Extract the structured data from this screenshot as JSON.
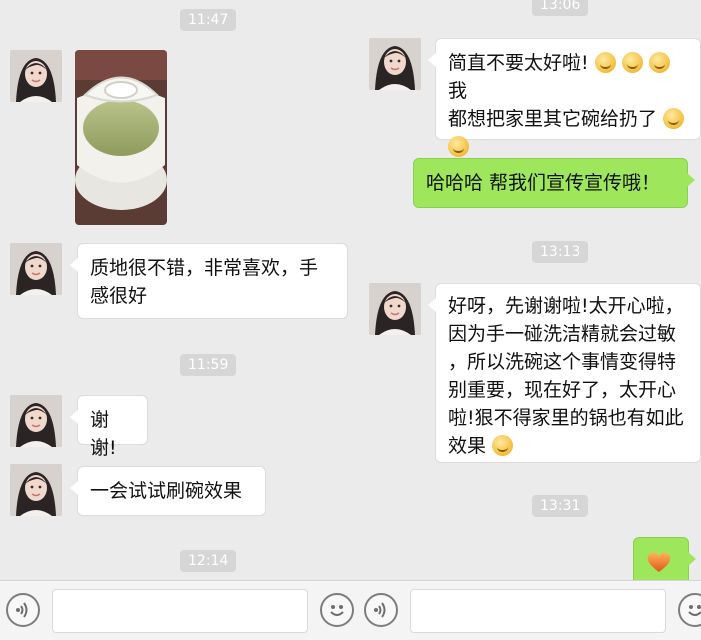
{
  "left_screen": {
    "timestamps": [
      "11:47",
      "11:59",
      "12:14"
    ],
    "messages": [
      {
        "type": "image",
        "content": "bowl-photo"
      },
      {
        "type": "text",
        "line1": "质地很不错，非常喜欢，手",
        "line2": "感很好"
      },
      {
        "type": "text",
        "text": "谢谢!"
      },
      {
        "type": "text",
        "text": "一会试试刷碗效果"
      }
    ],
    "input": {
      "voice_icon": "voice-icon",
      "emoji_icon": "smiley-icon"
    }
  },
  "right_screen": {
    "timestamps": [
      "13:06",
      "13:13",
      "13:31"
    ],
    "messages": [
      {
        "type": "text",
        "line1_before": "简直不要太好啦!",
        "line1_after": "我",
        "line2": "都想把家里其它碗给扔了"
      },
      {
        "type": "text",
        "text": "哈哈哈 帮我们宣传宣传哦！"
      },
      {
        "type": "text",
        "lines": [
          "好呀，先谢谢啦!太开心啦，",
          "因为手一碰洗洁精就会过敏",
          "，所以洗碗这个事情变得特",
          "别重要，现在好了，太开心",
          "啦!狠不得家里的锅也有如此",
          "效果"
        ]
      },
      {
        "type": "sticker",
        "content": "heart"
      }
    ],
    "input": {
      "voice_icon": "voice-icon",
      "emoji_icon": "smiley-icon"
    }
  },
  "colors": {
    "background": "#ebebeb",
    "outgoing": "#9ee75c",
    "incoming": "#ffffff",
    "timestamp": "#d6d6d6"
  }
}
